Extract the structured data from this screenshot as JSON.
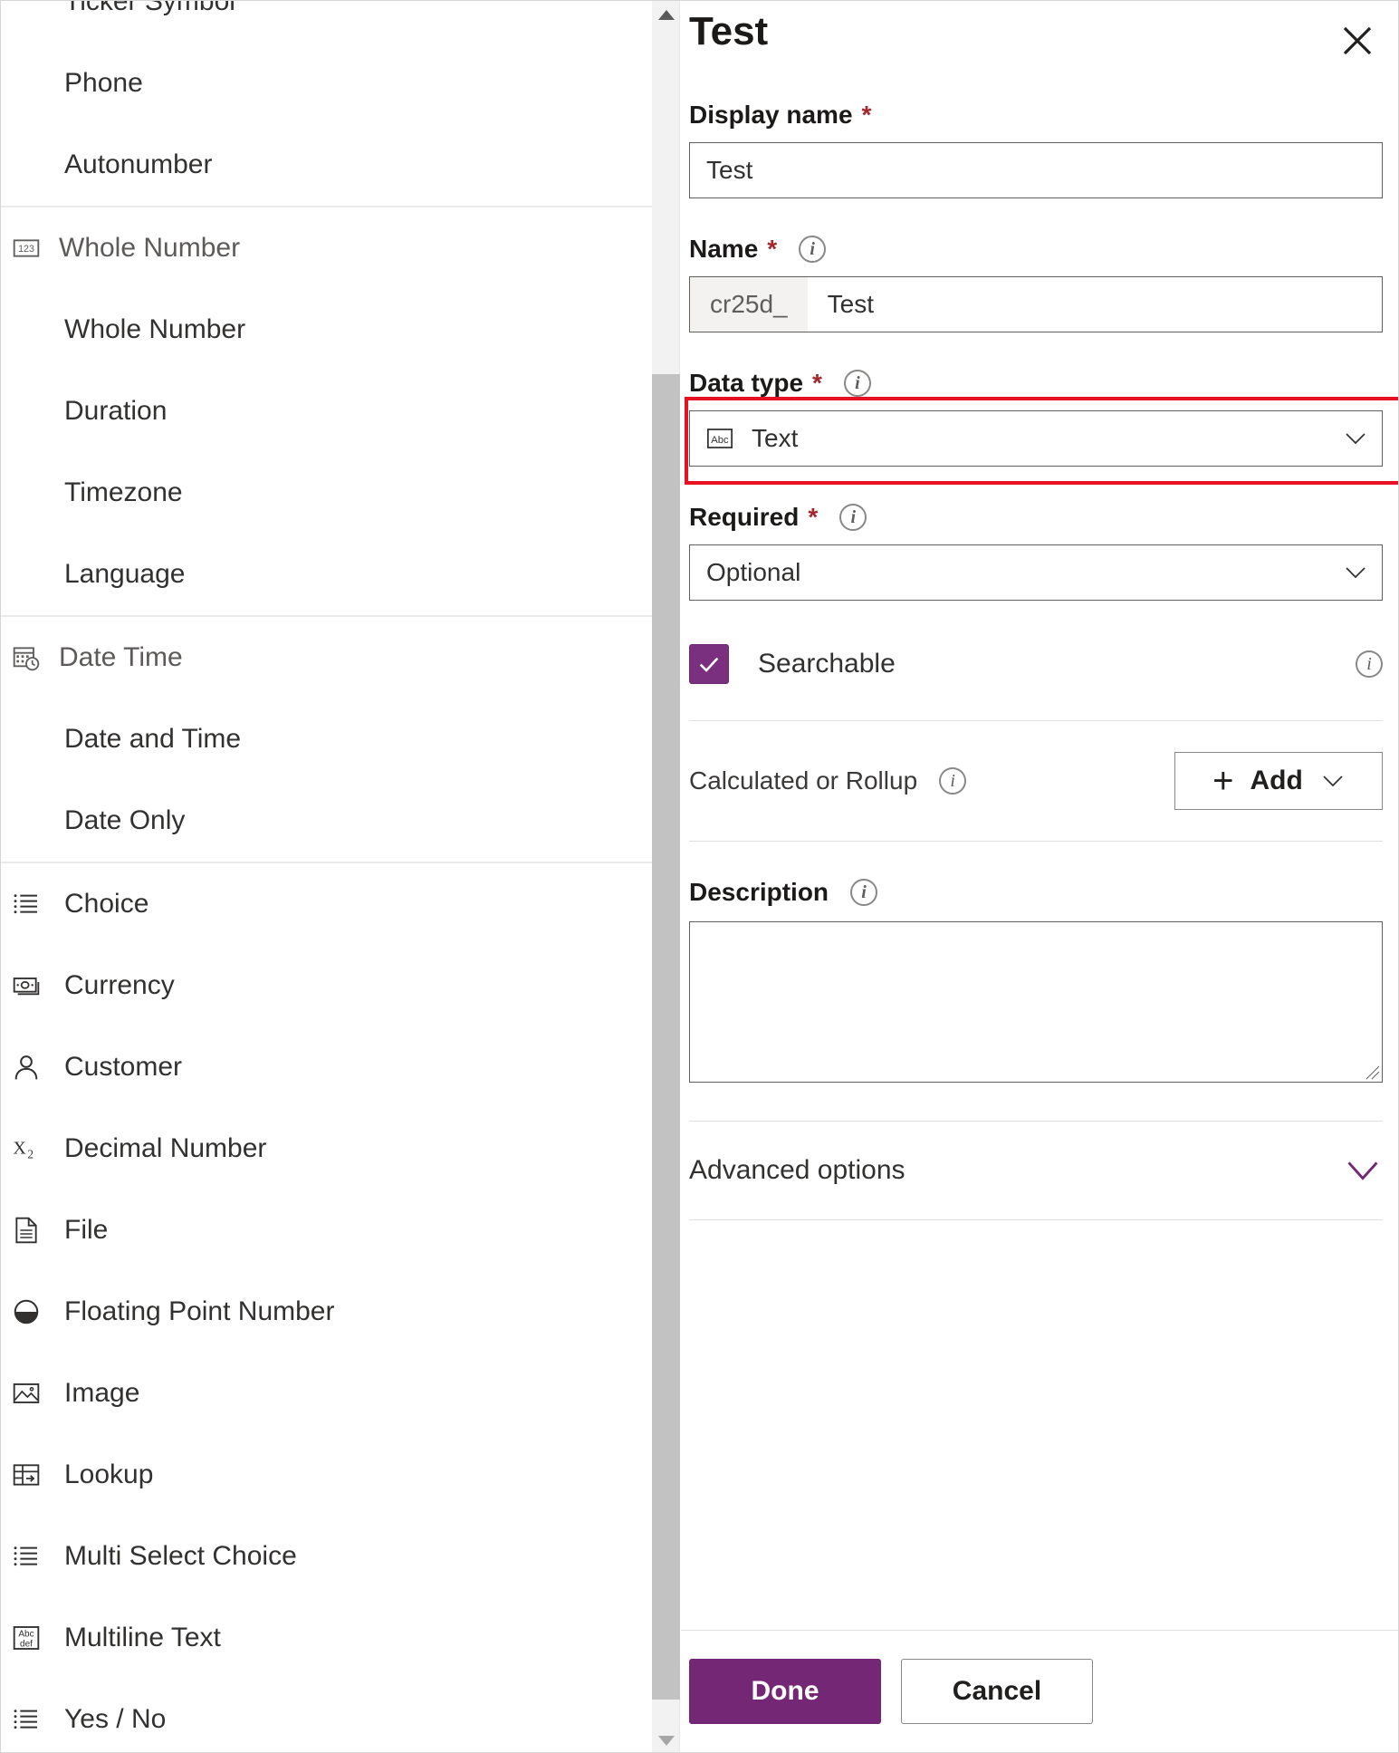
{
  "left_list": {
    "clipped_top_item": "Ticker Symbol",
    "groups": [
      {
        "header": null,
        "header_icon": null,
        "items": [
          {
            "label": "Phone",
            "icon": null
          },
          {
            "label": "Autonumber",
            "icon": null
          }
        ]
      },
      {
        "header": "Whole Number",
        "header_icon": "123-box-icon",
        "items": [
          {
            "label": "Whole Number",
            "icon": null
          },
          {
            "label": "Duration",
            "icon": null
          },
          {
            "label": "Timezone",
            "icon": null
          },
          {
            "label": "Language",
            "icon": null
          }
        ]
      },
      {
        "header": "Date Time",
        "header_icon": "calendar-clock-icon",
        "items": [
          {
            "label": "Date and Time",
            "icon": null
          },
          {
            "label": "Date Only",
            "icon": null
          }
        ]
      },
      {
        "header": null,
        "header_icon": null,
        "items": [
          {
            "label": "Choice",
            "icon": "list-icon"
          },
          {
            "label": "Currency",
            "icon": "banknote-icon"
          },
          {
            "label": "Customer",
            "icon": "person-icon"
          },
          {
            "label": "Decimal Number",
            "icon": "x-subscript-2-icon"
          },
          {
            "label": "File",
            "icon": "file-icon"
          },
          {
            "label": "Floating Point Number",
            "icon": "half-filled-circle-icon"
          },
          {
            "label": "Image",
            "icon": "image-icon"
          },
          {
            "label": "Lookup",
            "icon": "lookup-table-icon"
          },
          {
            "label": "Multi Select Choice",
            "icon": "list-icon"
          },
          {
            "label": "Multiline Text",
            "icon": "abc-def-box-icon"
          },
          {
            "label": "Yes / No",
            "icon": "list-icon"
          }
        ]
      }
    ]
  },
  "panel": {
    "title": "Test",
    "close_icon": "close-icon",
    "display_name": {
      "label": "Display name",
      "required_marker": "*",
      "value": "Test"
    },
    "name": {
      "label": "Name",
      "required_marker": "*",
      "info_icon": "info-icon",
      "prefix": "cr25d_",
      "value": "Test"
    },
    "data_type": {
      "label": "Data type",
      "required_marker": "*",
      "info_icon": "info-icon",
      "icon": "abc-box-icon",
      "value": "Text",
      "chevron_icon": "chevron-down-icon",
      "highlight_color": "#e81123"
    },
    "required": {
      "label": "Required",
      "required_marker": "*",
      "info_icon": "info-icon",
      "value": "Optional",
      "chevron_icon": "chevron-down-icon"
    },
    "searchable": {
      "label": "Searchable",
      "checked": true,
      "check_icon": "checkmark-icon",
      "info_icon": "info-icon",
      "accent_color": "#7a2f7f"
    },
    "calculated_or_rollup": {
      "label": "Calculated or Rollup",
      "info_icon": "info-icon",
      "add_label": "Add",
      "plus_icon": "plus-icon",
      "chevron_icon": "chevron-down-icon"
    },
    "description": {
      "label": "Description",
      "info_icon": "info-icon",
      "value": ""
    },
    "advanced_options": {
      "label": "Advanced options",
      "chevron_icon": "chevron-down-icon",
      "chevron_color": "#742774"
    }
  },
  "footer": {
    "done_label": "Done",
    "cancel_label": "Cancel",
    "primary_color": "#742774"
  },
  "scrollbar": {
    "up_arrow_icon": "caret-up-icon",
    "down_arrow_icon": "caret-down-icon"
  }
}
